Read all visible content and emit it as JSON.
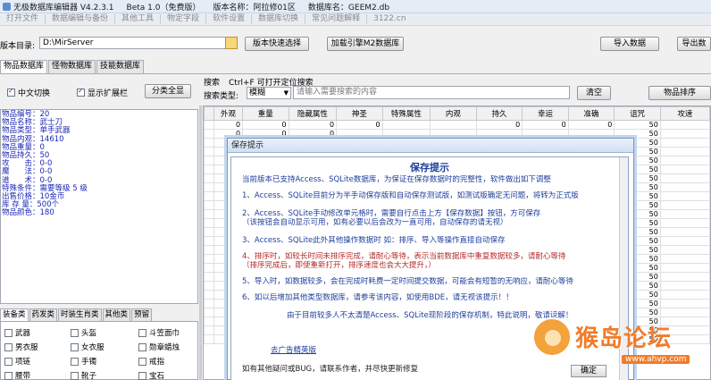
{
  "titlebar": {
    "app": "无极数据库编辑器 V4.2.3.1",
    "version": "Beta 1.0（免费版）",
    "edition": "版本名称：阿拉修01区",
    "db": "数据库名：GEEM2.db"
  },
  "menu": [
    "打开文件",
    "数据编辑与备份",
    "其他工具",
    "物定字段",
    "软件设置",
    "数据库切换",
    "常见问题解释",
    "3122.cn"
  ],
  "toolbar": {
    "dir_label": "版本目录:",
    "dir_value": "D:\\MirServer",
    "version_select_btn": "版本快速选择",
    "load_engine_btn": "加载引擎M2数据库",
    "import_btn": "导入数据",
    "export_btn": "导出数"
  },
  "db_tabs": [
    "物品数据库",
    "怪物数据库",
    "技能数据库"
  ],
  "options": {
    "cn_switch": "中文切换",
    "show_ext": "显示扩展栏",
    "classify_all": "分类全显"
  },
  "search": {
    "title": "搜索",
    "hint": "Ctrl+F 可打开定位搜索",
    "type_label": "搜索类型:",
    "type_value": "模糊",
    "placeholder": "请输入需要搜索的内容",
    "clear_btn": "清空",
    "sort_btn": "物品排序"
  },
  "info_lines": [
    "物品编号：20",
    "物品名称：武士刀",
    "物品类型：单手武器",
    "物品内观：14610",
    "物品重量：0",
    "物品持久：50",
    "攻　　击：0-0",
    "魔　　法：0-0",
    "道　　术：0-0",
    "特殊条件：需要等级 5 级",
    "出售价格：10金币",
    "库 存 量：500个",
    "物品颜色：180"
  ],
  "category_tabs": [
    "装备类",
    "药发类",
    "时装生肖类",
    "其他类",
    "预留"
  ],
  "categories": [
    [
      "武器",
      "头盔",
      "斗笠面巾"
    ],
    [
      "男衣服",
      "女衣服",
      "勋章蜡烛"
    ],
    [
      "项链",
      "手镯",
      "戒指"
    ],
    [
      "腰带",
      "靴子",
      "宝石"
    ]
  ],
  "grid": {
    "columns": [
      "",
      "外观",
      "重量",
      "隐藏属性",
      "神圣",
      "特殊属性",
      "内观",
      "持久",
      "幸运",
      "准确",
      "诅咒",
      "攻速"
    ],
    "rows": [
      [
        "",
        "0",
        "0",
        "0",
        "0",
        "",
        "",
        "0",
        "0",
        "0",
        "50",
        ""
      ],
      [
        "",
        "0",
        "0",
        "0",
        "",
        "",
        "",
        "",
        "",
        "",
        "50",
        ""
      ],
      [
        "",
        "",
        "",
        "",
        "",
        "",
        "",
        "",
        "",
        "",
        "50",
        ""
      ],
      [
        "",
        "",
        "",
        "",
        "",
        "",
        "",
        "",
        "",
        "",
        "50",
        ""
      ],
      [
        "",
        "",
        "",
        "",
        "",
        "",
        "",
        "",
        "",
        "",
        "50",
        ""
      ],
      [
        "",
        "",
        "",
        "",
        "",
        "",
        "",
        "",
        "",
        "",
        "50",
        ""
      ],
      [
        "",
        "",
        "",
        "",
        "",
        "",
        "",
        "",
        "",
        "",
        "50",
        ""
      ],
      [
        "",
        "",
        "",
        "",
        "",
        "",
        "",
        "",
        "",
        "",
        "50",
        ""
      ],
      [
        "",
        "",
        "",
        "",
        "",
        "",
        "",
        "",
        "",
        "",
        "50",
        ""
      ],
      [
        "",
        "",
        "",
        "",
        "",
        "",
        "",
        "",
        "",
        "",
        "50",
        ""
      ],
      [
        "",
        "",
        "",
        "",
        "",
        "",
        "",
        "",
        "",
        "",
        "50",
        ""
      ],
      [
        "",
        "",
        "",
        "",
        "",
        "",
        "",
        "",
        "",
        "",
        "50",
        ""
      ],
      [
        "",
        "",
        "",
        "",
        "",
        "",
        "",
        "",
        "",
        "",
        "50",
        ""
      ],
      [
        "",
        "",
        "",
        "",
        "",
        "",
        "",
        "",
        "",
        "",
        "50",
        ""
      ],
      [
        "",
        "",
        "",
        "",
        "",
        "",
        "",
        "",
        "",
        "",
        "50",
        ""
      ],
      [
        "",
        "",
        "",
        "",
        "",
        "",
        "",
        "",
        "",
        "",
        "50",
        ""
      ],
      [
        "",
        "",
        "",
        "",
        "",
        "",
        "",
        "",
        "",
        "",
        "50",
        ""
      ],
      [
        "",
        "",
        "",
        "",
        "",
        "",
        "",
        "",
        "",
        "",
        "50",
        ""
      ],
      [
        "",
        "",
        "",
        "",
        "",
        "",
        "",
        "",
        "",
        "",
        "50",
        ""
      ],
      [
        "",
        "",
        "",
        "",
        "",
        "",
        "",
        "",
        "",
        "",
        "50",
        ""
      ],
      [
        "",
        "",
        "",
        "",
        "",
        "",
        "",
        "",
        "",
        "",
        "50",
        ""
      ],
      [
        "",
        "",
        "",
        "",
        "",
        "",
        "",
        "",
        "",
        "",
        "50",
        ""
      ],
      [
        "",
        "",
        "",
        "",
        "",
        "",
        "",
        "",
        "",
        "",
        "50",
        ""
      ],
      [
        "",
        "",
        "",
        "",
        "",
        "",
        "",
        "",
        "",
        "",
        "50",
        ""
      ],
      [
        "",
        "",
        "",
        "",
        "",
        "",
        "",
        "",
        "",
        "",
        "50",
        ""
      ]
    ]
  },
  "dialog": {
    "title": "保存提示",
    "heading": "保存提示",
    "lines": [
      "当前版本已支持Access、SQLite数据库，为保证在保存数据时的完整性，软件做出如下调整",
      "1、Access、SQLite目前分为半手动保存版和自动保存测试版，如测试版确定无问题，将转为正式版",
      "2、Access、SQLite手动修改单元格时，需要自行点击上方【保存数据】按钮，方可保存",
      "（该按钮会自动显示可用，如有必要以后会改为一直可用，自动保存的请无视）",
      "3、Access、SQLite此外其他操作数据时 如：排序、导入等操作直接自动保存",
      "4、排序时，如较长时间未排序完成，请耐心等待，表示当前数据库中重复数据较多，请耐心等待",
      "（排序完成后，即使重新打开，排序速度也会大大提升，）",
      "5、导入时，如数据较多，会在完成时耗费一定时间提交数据，可能会有短暂的无响应，请耐心等待",
      "6、如以后增加其他类型数据库，请参考该内容，如使用BDE，请无视该提示！！",
      "由于目前较多人不太清楚Access、SQLite现阶段的保存机制，特此说明，敬请谅解！"
    ],
    "link": "去广告精英版",
    "contact": "如有其他疑问或BUG，请联系作者，并尽快更新修复",
    "ok": "确定"
  },
  "watermark": {
    "text": "猴岛论坛",
    "url": "www.ahvp.com"
  }
}
